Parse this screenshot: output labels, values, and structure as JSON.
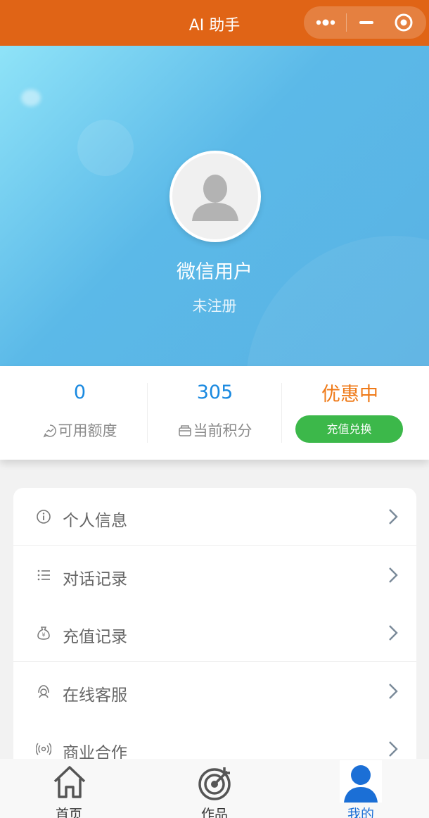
{
  "window": {
    "title": "AI 助手"
  },
  "profile": {
    "name": "微信用户",
    "status": "未注册"
  },
  "stats": {
    "quota_value": "0",
    "quota_label": "可用额度",
    "points_value": "305",
    "points_label": "当前积分",
    "promo_label": "优惠中",
    "recharge_button": "充值兑换"
  },
  "menu": [
    {
      "label": "个人信息",
      "icon": "info-icon"
    },
    {
      "label": "对话记录",
      "icon": "list-icon"
    },
    {
      "label": "充值记录",
      "icon": "money-bag-icon"
    },
    {
      "label": "在线客服",
      "icon": "headset-icon"
    },
    {
      "label": "商业合作",
      "icon": "broadcast-icon"
    }
  ],
  "tabs": [
    {
      "label": "首页",
      "icon": "home-icon"
    },
    {
      "label": "作品",
      "icon": "target-icon"
    },
    {
      "label": "我的",
      "icon": "user-icon"
    }
  ],
  "colors": {
    "topbar": "#e06416",
    "accent_blue": "#1989e0",
    "promo_orange": "#ef7a18",
    "button_green": "#3cb84a"
  }
}
